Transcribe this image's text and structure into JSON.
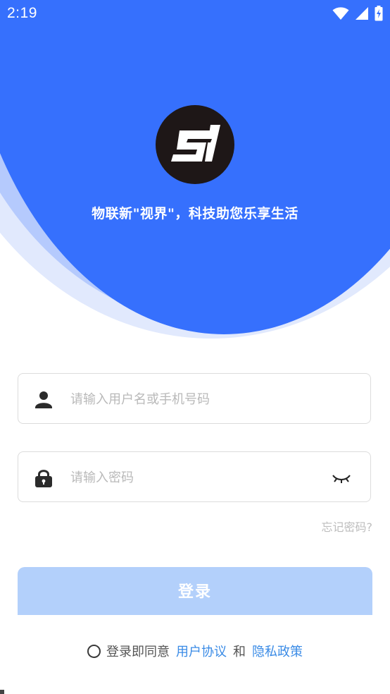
{
  "status_bar": {
    "time": "2:19",
    "icons": [
      "wifi-icon",
      "signal-icon",
      "battery-icon"
    ]
  },
  "header": {
    "logo_icon": "sj-logo-icon",
    "tagline": "物联新\"视界\"，科技助您乐享生活",
    "colors": {
      "primary": "#3670fd",
      "secondary_wave": "#a9c1fd",
      "tertiary_wave": "#dbe5fd"
    }
  },
  "login_form": {
    "username": {
      "icon": "user-icon",
      "placeholder": "请输入用户名或手机号码",
      "value": ""
    },
    "password": {
      "icon": "lock-icon",
      "placeholder": "请输入密码",
      "value": "",
      "toggle_icon": "eye-closed-icon"
    },
    "forgot_password": "忘记密码?",
    "submit_label": "登录",
    "submit_color": "#b3d0fb"
  },
  "agreement": {
    "prefix": "登录即同意",
    "user_agreement": "用户协议",
    "conjunction": "和",
    "privacy_policy": "隐私政策",
    "link_color": "#3a8be6"
  }
}
